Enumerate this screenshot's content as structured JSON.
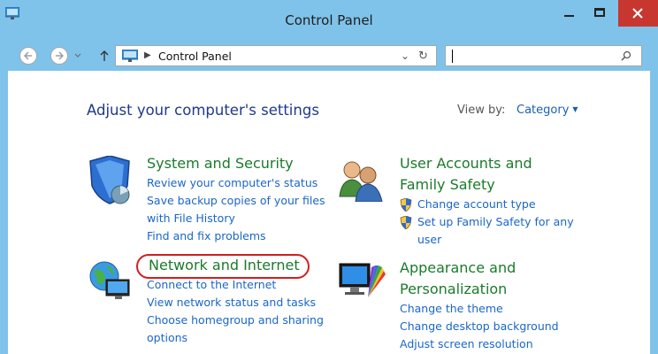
{
  "window": {
    "title": "Control Panel"
  },
  "address_bar": {
    "path": "Control Panel",
    "search_placeholder": ""
  },
  "header": {
    "heading": "Adjust your computer's settings",
    "view_by_label": "View by:",
    "view_by_value": "Category"
  },
  "categories": [
    {
      "title": "System and Security",
      "links": [
        "Review your computer's status",
        "Save backup copies of your files with File History",
        "Find and fix problems"
      ]
    },
    {
      "title": "Network and Internet",
      "links": [
        "Connect to the Internet",
        "View network status and tasks",
        "Choose homegroup and sharing options"
      ]
    },
    {
      "title_line1": "User Accounts and",
      "title_line2": "Family Safety",
      "links": [
        "Change account type",
        "Set up Family Safety for any user"
      ]
    },
    {
      "title_line1": "Appearance and",
      "title_line2": "Personalization",
      "links": [
        "Change the theme",
        "Change desktop background",
        "Adjust screen resolution"
      ]
    }
  ],
  "colors": {
    "frame": "#7fc3ea",
    "close_button": "#c7372f",
    "category_title": "#1b7a2b",
    "link": "#1a66c9",
    "highlight_ring": "#d21e1e"
  }
}
